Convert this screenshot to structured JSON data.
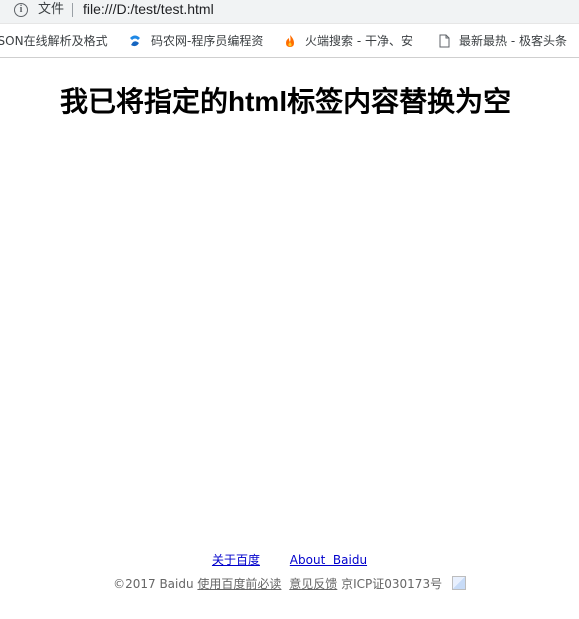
{
  "browser": {
    "file_label": "文件",
    "url": "file:///D:/test/test.html"
  },
  "bookmarks": [
    {
      "label": "JSON在线解析及格式",
      "icon": "bookmark-icon"
    },
    {
      "label": "码农网-程序员编程资",
      "icon": "codenong-icon"
    },
    {
      "label": "火端搜索 - 干净、安",
      "icon": "flame-icon"
    },
    {
      "label": "最新最热 - 极客头条",
      "icon": "page-icon"
    }
  ],
  "page": {
    "heading": "我已将指定的html标签内容替换为空"
  },
  "footer": {
    "about_cn": "关于百度",
    "about_en": "About  Baidu",
    "copyright": "©2017 Baidu",
    "terms": "使用百度前必读",
    "feedback": "意见反馈",
    "icp": "京ICP证030173号"
  }
}
